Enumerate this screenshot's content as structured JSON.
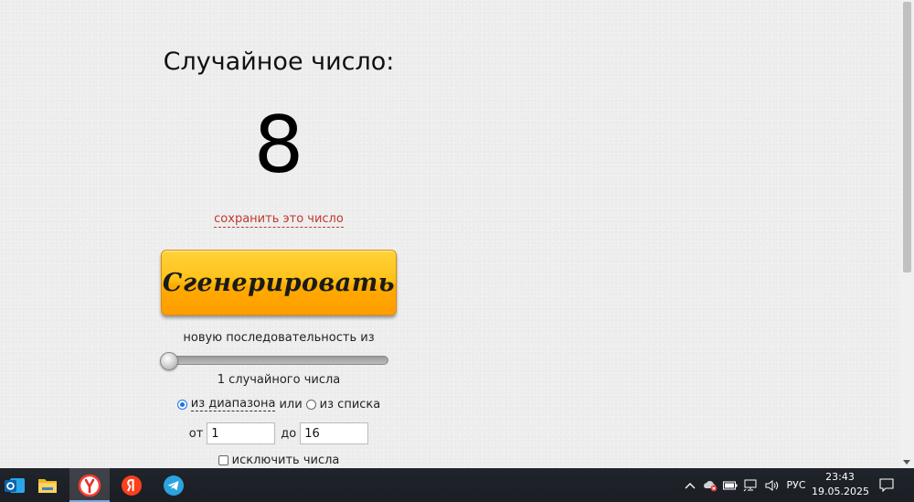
{
  "generator": {
    "heading": "Случайное число:",
    "result": "8",
    "save_link": "сохранить это число",
    "generate_button": "Сгенерировать",
    "sequence_label": "новую последовательность из",
    "count": 1,
    "count_label": "1 случайного числа",
    "mode": {
      "range_label": "из диапазона",
      "or_label": "или",
      "list_label": "из списка",
      "selected": "range"
    },
    "range": {
      "from_label": "от",
      "from_value": "1",
      "to_label": "до",
      "to_value": "16"
    },
    "exclude_label": "исключить числа",
    "exclude_checked": false
  },
  "taskbar": {
    "apps": [
      "outlook-icon",
      "file-explorer-icon",
      "yandex-browser-icon",
      "yandex-icon",
      "telegram-icon"
    ],
    "active_app": "yandex-browser-icon",
    "tray": {
      "language": "РУС",
      "time": "23:43",
      "date": "19.05.2025"
    }
  },
  "colors": {
    "link": "#c0392b",
    "button_top": "#ffd33a",
    "button_bottom": "#ff9d00",
    "taskbar": "#1f232a"
  }
}
